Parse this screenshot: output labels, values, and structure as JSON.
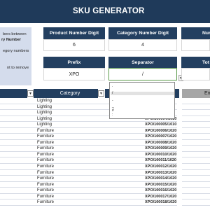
{
  "header": {
    "title": "SKU GENERATOR"
  },
  "info_box": {
    "lines": [
      "bers between",
      "ry Number",
      "egory numbers",
      "nt to remove"
    ]
  },
  "settings": {
    "product_digit_label": "Product Number Digit",
    "product_digit_value": "6",
    "category_digit_label": "Category Number Digit",
    "category_digit_value": "4",
    "number_label": "Numb",
    "prefix_label": "Prefix",
    "prefix_value": "XPO",
    "separator_label": "Separator",
    "separator_value": "/",
    "total_label": "Tot"
  },
  "separator_options": [
    ".",
    "/",
    "-",
    "_",
    "#",
    ":"
  ],
  "separator_selected_index": 1,
  "table": {
    "category_header": "Category",
    "right_header": "Em",
    "rows": [
      {
        "category": "Lighting",
        "sku": ""
      },
      {
        "category": "Lighting",
        "sku": ""
      },
      {
        "category": "Lighting",
        "sku": ""
      },
      {
        "category": "Lighting",
        "sku": "XPO/100004/1010"
      },
      {
        "category": "Lighting",
        "sku": "XPO/100005/1010"
      },
      {
        "category": "Furniture",
        "sku": "XPO/100006/1020"
      },
      {
        "category": "Furniture",
        "sku": "XPO/100007/1020"
      },
      {
        "category": "Furniture",
        "sku": "XPO/100008/1020"
      },
      {
        "category": "Furniture",
        "sku": "XPO/100009/1020"
      },
      {
        "category": "Furniture",
        "sku": "XPO/100010/1020"
      },
      {
        "category": "Furniture",
        "sku": "XPO/100011/1020"
      },
      {
        "category": "Furniture",
        "sku": "XPO/100012/1020"
      },
      {
        "category": "Furniture",
        "sku": "XPO/100013/1020"
      },
      {
        "category": "Furniture",
        "sku": "XPO/100014/1020"
      },
      {
        "category": "Furniture",
        "sku": "XPO/100015/1020"
      },
      {
        "category": "Furniture",
        "sku": "XPO/100016/1020"
      },
      {
        "category": "Furniture",
        "sku": "XPO/100017/1020"
      },
      {
        "category": "Furniture",
        "sku": "XPO/100018/1020"
      }
    ]
  },
  "colors": {
    "title_bar": "#1f3a5a",
    "header_fill": "#233f60",
    "info_box": "#d4dcec",
    "gray_header": "#a6a6a6"
  }
}
